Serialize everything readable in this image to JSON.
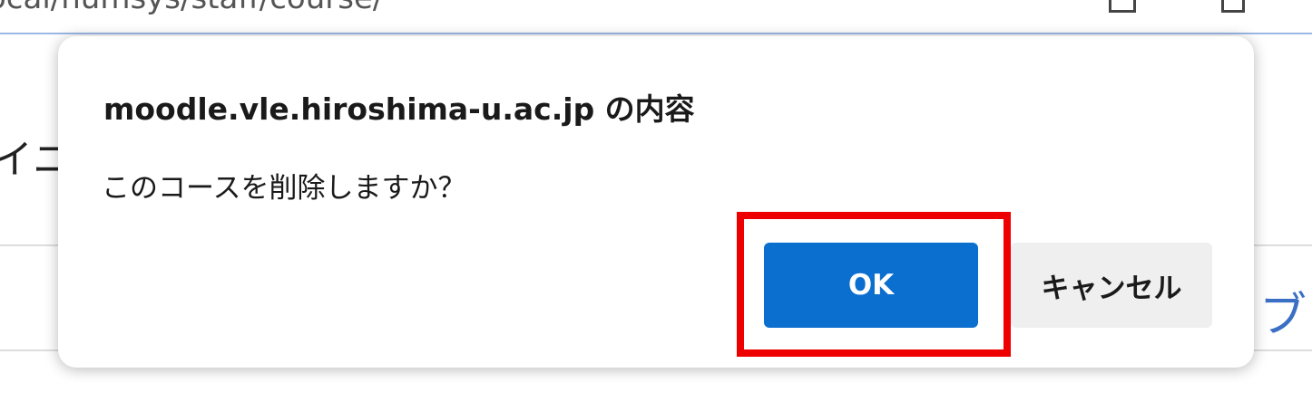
{
  "browser": {
    "address_text": "ocal/numsys/staff/course/"
  },
  "page": {
    "left_fragment": "イニ",
    "right_fragment": "ブ"
  },
  "dialog": {
    "title": "moodle.vle.hiroshima-u.ac.jp の内容",
    "message": "このコースを削除しますか？",
    "ok_label": "OK",
    "cancel_label": "キャンセル"
  },
  "colors": {
    "ok_button": "#0b6fd0",
    "cancel_button": "#efefef",
    "highlight": "#ee0000"
  }
}
